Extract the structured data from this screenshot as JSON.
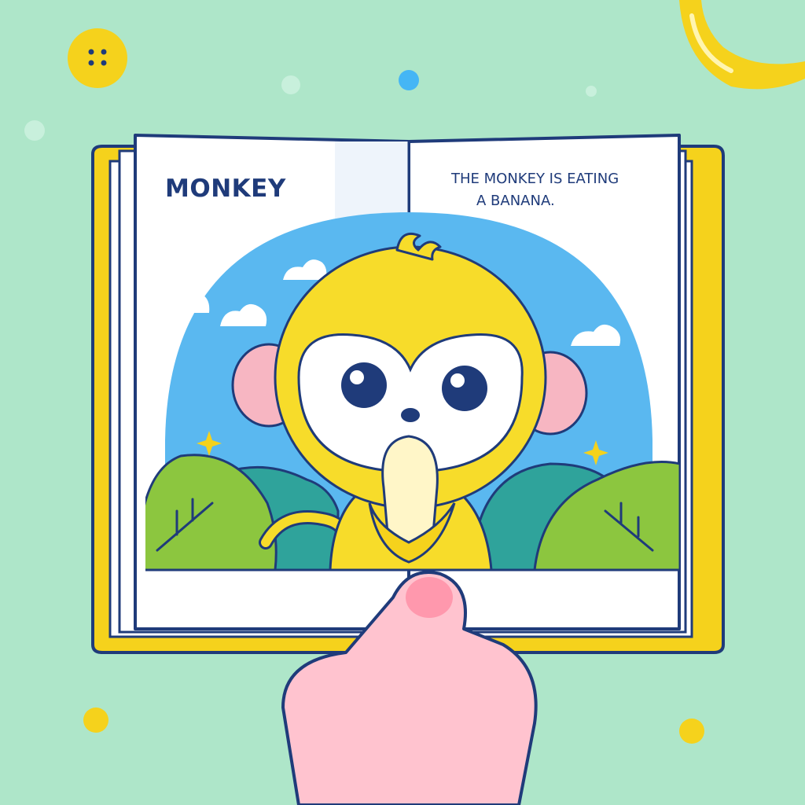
{
  "book": {
    "left_page": {
      "title": "MONKEY"
    },
    "right_page": {
      "caption_line_1": "THE MONKEY IS EATING",
      "caption_line_2": "A BANANA."
    }
  },
  "colors": {
    "background": "#aee6c9",
    "book_cover": "#f5d21c",
    "outline": "#1f3b7a",
    "sky": "#5ab8f0",
    "monkey_fur": "#f7dc2a",
    "monkey_face": "#ffffff",
    "ear_inner": "#f7b6c2",
    "bush_light": "#8cc63f",
    "bush_dark": "#2fa39b",
    "hand": "#ffc3cf",
    "banana": "#f5d21c"
  },
  "icons": [
    "button-icon",
    "banana-icon",
    "cloud-icon",
    "sparkle-icon"
  ]
}
